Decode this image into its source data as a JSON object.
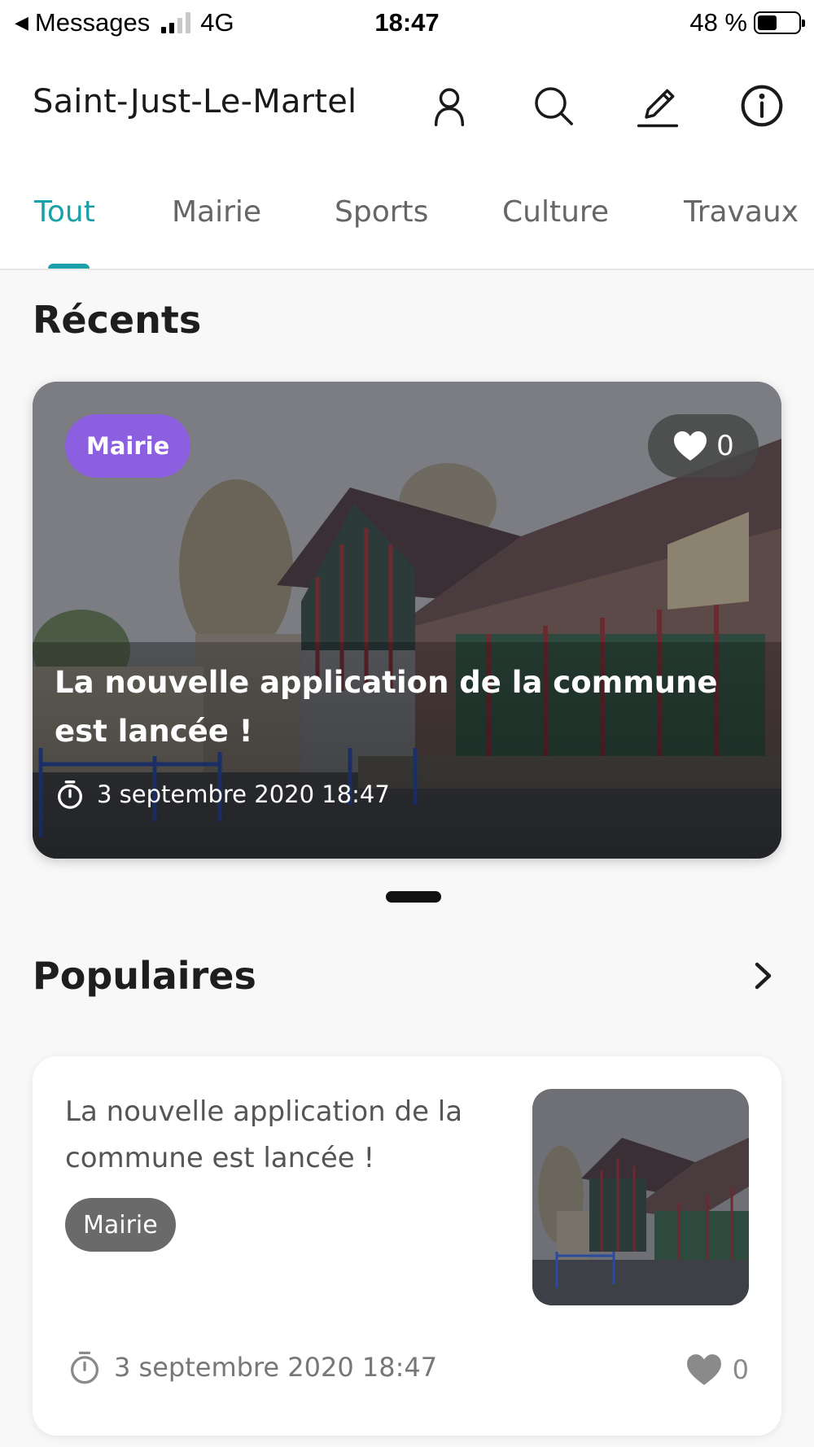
{
  "status_bar": {
    "back_label": "Messages",
    "network": "4G",
    "time": "18:47",
    "battery": "48 %",
    "battery_level": 0.48
  },
  "header": {
    "title": "Saint-Just-Le-Martel",
    "icons": [
      "user-icon",
      "search-icon",
      "pencil-icon",
      "info-icon"
    ]
  },
  "tabs": [
    {
      "label": "Tout",
      "active": true
    },
    {
      "label": "Mairie",
      "active": false
    },
    {
      "label": "Sports",
      "active": false
    },
    {
      "label": "Culture",
      "active": false
    },
    {
      "label": "Travaux",
      "active": false
    }
  ],
  "recents": {
    "title": "Récents",
    "card": {
      "tag": "Mairie",
      "tag_color": "#8b5fe0",
      "likes": "0",
      "title": "La nouvelle application de la commune est lancée !",
      "date": "3 septembre 2020 18:47"
    }
  },
  "popular": {
    "title": "Populaires",
    "card": {
      "title": "La nouvelle application de la commune est lancée !",
      "tag": "Mairie",
      "date": "3 septembre 2020 18:47",
      "likes": "0"
    }
  },
  "accent_color": "#1aa0a8"
}
